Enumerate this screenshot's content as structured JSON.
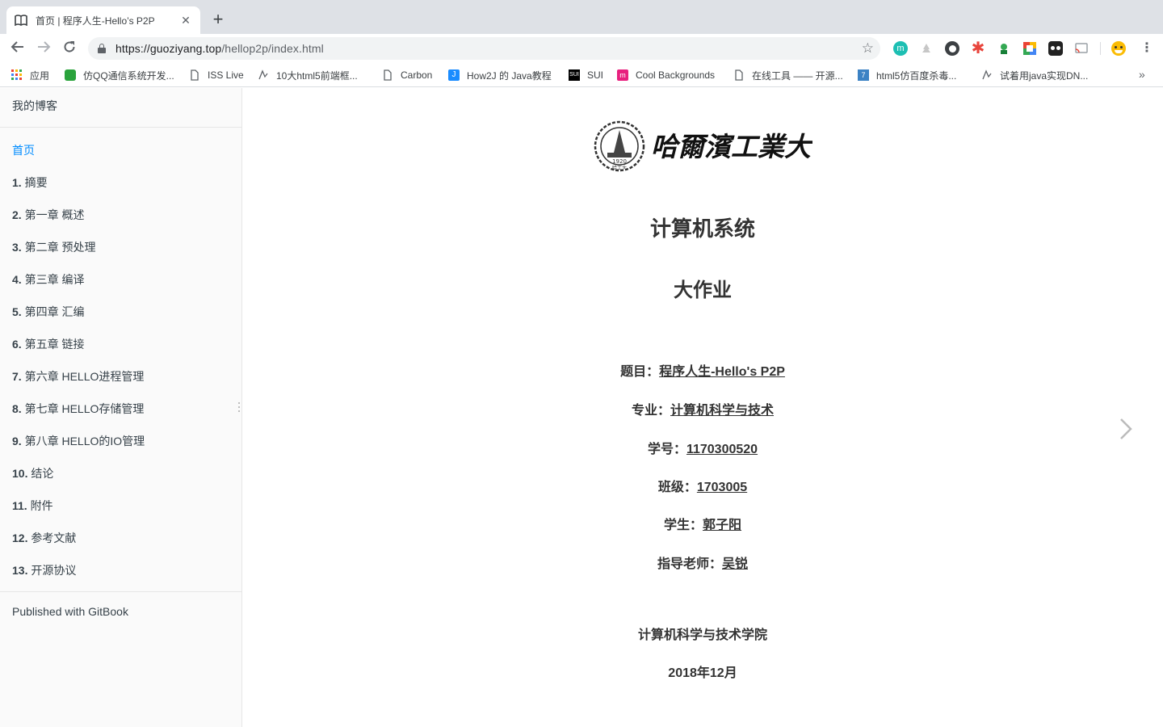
{
  "browser": {
    "tab": {
      "title": "首页 | 程序人生-Hello’s P2P",
      "favicon": "book-icon"
    },
    "url": {
      "domain": "https://guoziyang.top",
      "path": "/hellop2p/index.html"
    },
    "bookmarks": [
      {
        "label": "应用",
        "icon": "apps-grid-icon"
      },
      {
        "label": "仿QQ通信系统开发...",
        "icon": "green-leaf-icon"
      },
      {
        "label": "ISS Live",
        "icon": "page-icon"
      },
      {
        "label": "10大html5前端框...",
        "icon": "link-icon"
      },
      {
        "label": "Carbon",
        "icon": "page-icon"
      },
      {
        "label": "How2J 的 Java教程",
        "icon": "how2j-icon"
      },
      {
        "label": "SUI",
        "icon": "sui-icon"
      },
      {
        "label": "Cool Backgrounds",
        "icon": "pink-logo-icon"
      },
      {
        "label": "在线工具 —— 开源...",
        "icon": "page-icon"
      },
      {
        "label": "html5仿百度杀毒...",
        "icon": "seven-icon"
      },
      {
        "label": "试着用java实现DN...",
        "icon": "link-icon"
      }
    ]
  },
  "sidebar": {
    "header": "我的博客",
    "items": [
      {
        "num": "",
        "label": "首页"
      },
      {
        "num": "1.",
        "label": "摘要"
      },
      {
        "num": "2.",
        "label": "第一章 概述"
      },
      {
        "num": "3.",
        "label": "第二章 预处理"
      },
      {
        "num": "4.",
        "label": "第三章 编译"
      },
      {
        "num": "5.",
        "label": "第四章 汇编"
      },
      {
        "num": "6.",
        "label": "第五章 链接"
      },
      {
        "num": "7.",
        "label": "第六章 HELLO进程管理"
      },
      {
        "num": "8.",
        "label": "第七章 HELLO存储管理"
      },
      {
        "num": "9.",
        "label": "第八章 HELLO的IO管理"
      },
      {
        "num": "10.",
        "label": "结论"
      },
      {
        "num": "11.",
        "label": "附件"
      },
      {
        "num": "12.",
        "label": "参考文献"
      },
      {
        "num": "13.",
        "label": "开源协议"
      }
    ],
    "footer": "Published with GitBook"
  },
  "main": {
    "logo_text": "哈爾濱工業大學",
    "logo_seal_text": "1920",
    "logo_seal_bottom": "哈工大",
    "title": "计算机系统",
    "subtitle": "大作业",
    "fields": [
      {
        "label": "题目：",
        "value": "程序人生-Hello's P2P"
      },
      {
        "label": "专业：",
        "value": "计算机科学与技术"
      },
      {
        "label": "学号：",
        "value": "1170300520"
      },
      {
        "label": "班级：",
        "value": "1703005"
      },
      {
        "label": "学生：",
        "value": "郭子阳"
      },
      {
        "label": "指导老师：",
        "value": "吴锐"
      }
    ],
    "school": "计算机科学与技术学院",
    "date": "2018年12月"
  }
}
